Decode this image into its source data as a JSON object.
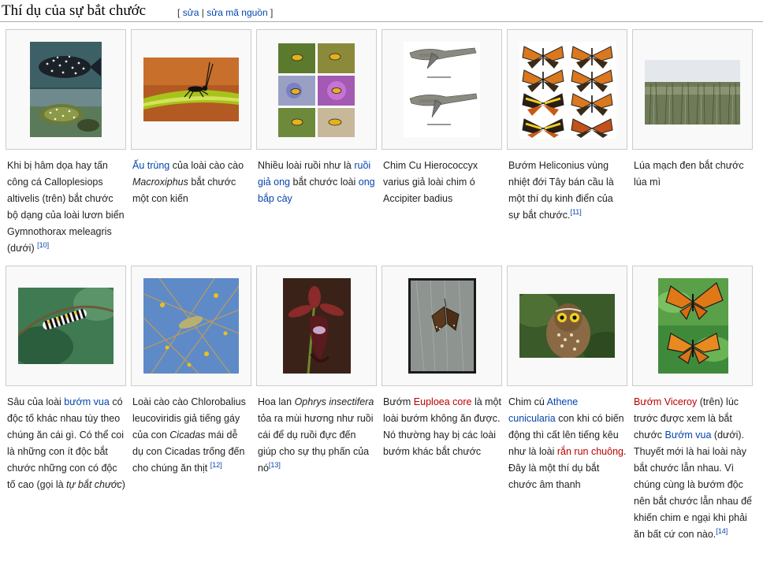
{
  "section": {
    "title": "Thí dụ của sự bắt chước",
    "edit_open": "[",
    "edit": "sửa",
    "sep": "|",
    "edit_source": "sửa mã nguồn",
    "edit_close": "]"
  },
  "gallery": {
    "items": [
      {
        "image": "fish-photo",
        "caption": [
          {
            "t": "Khi bị hâm dọa hay tấn công cá Calloplesiops altivelis (trên) bắt chước bộ dạng của loài lươn biển Gymnothorax meleagris (dưới) "
          },
          {
            "t": "[10]",
            "sup": true
          }
        ]
      },
      {
        "image": "grasshopper-photo",
        "caption": [
          {
            "t": "Ấu trùng",
            "link": true
          },
          {
            "t": " của loài cào cào "
          },
          {
            "t": "Macroxiphus",
            "i": true
          },
          {
            "t": " bắt chước một con kiến"
          }
        ]
      },
      {
        "image": "hoverfly-photos",
        "caption": [
          {
            "t": "Nhiều loài ruồi như là "
          },
          {
            "t": "ruồi giả ong",
            "link": true
          },
          {
            "t": " bắt chước loài "
          },
          {
            "t": "ong bắp cày",
            "link": true
          }
        ]
      },
      {
        "image": "cuckoo-drawing",
        "caption": [
          {
            "t": "Chim Cu Hierococcyx varius giả loài chim ó Accipiter badius"
          }
        ]
      },
      {
        "image": "heliconius-butterflies",
        "caption": [
          {
            "t": "Bướm Heliconius vùng nhiệt đới Tây bán cầu là một thí dụ kinh điển của sự bắt chước."
          },
          {
            "t": "[11]",
            "sup": true
          }
        ]
      },
      {
        "image": "rye-field-photo",
        "caption": [
          {
            "t": "Lúa mạch đen bắt chước lúa mì"
          }
        ]
      },
      {
        "image": "caterpillar-photo",
        "caption": [
          {
            "t": "Sâu của loài "
          },
          {
            "t": "bướm vua",
            "link": true
          },
          {
            "t": " có độc tố khác nhau tùy theo chúng ăn cái gì. Có thể coi là những con ít độc bắt chước những con có độc tố cao (gọi là "
          },
          {
            "t": "tự bắt chước",
            "i": true
          },
          {
            "t": ")"
          }
        ]
      },
      {
        "image": "katydid-photo",
        "caption": [
          {
            "t": "Loài cào cào Chlorobalius leucoviridis giả tiếng gáy của con "
          },
          {
            "t": "Cicadas",
            "i": true
          },
          {
            "t": " mái dễ dụ con Cicadas trống đến cho chúng ăn thịt "
          },
          {
            "t": "[12]",
            "sup": true
          }
        ]
      },
      {
        "image": "orchid-photo",
        "caption": [
          {
            "t": "Hoa lan "
          },
          {
            "t": "Ophrys insectifera",
            "i": true
          },
          {
            "t": " tỏa ra mùi hương như ruồi cái để dụ ruồi đực đến giúp cho sự thụ phấn của nó"
          },
          {
            "t": "[13]",
            "sup": true
          }
        ]
      },
      {
        "image": "euploea-photo",
        "caption": [
          {
            "t": "Bướm "
          },
          {
            "t": "Euploea core",
            "link": true,
            "red": true
          },
          {
            "t": " là một loài bướm không ăn được. Nó thường hay bị các loài bướm khác bắt chước"
          }
        ]
      },
      {
        "image": "owl-photo",
        "caption": [
          {
            "t": "Chim cú "
          },
          {
            "t": "Athene cunicularia",
            "link": true
          },
          {
            "t": " con khi có biến động thì cất lên tiếng kêu như là loài "
          },
          {
            "t": "rắn run chuông",
            "link": true,
            "red": true
          },
          {
            "t": ". Đây là một thí dụ bắt chước âm thanh"
          }
        ]
      },
      {
        "image": "viceroy-monarch-photo",
        "caption": [
          {
            "t": "Bướm Viceroy",
            "link": true,
            "red": true
          },
          {
            "t": " (trên) lúc trước được xem là bắt chước "
          },
          {
            "t": "Bướm vua",
            "link": true
          },
          {
            "t": " (dưới). Thuyết mới là hai loài này bắt chước lẫn nhau. Vì chúng cùng là bướm độc nên bắt chước lẫn nhau để khiến chim e ngại khi phải ăn bất cứ con nào."
          },
          {
            "t": "[14]",
            "sup": true
          }
        ]
      }
    ]
  }
}
